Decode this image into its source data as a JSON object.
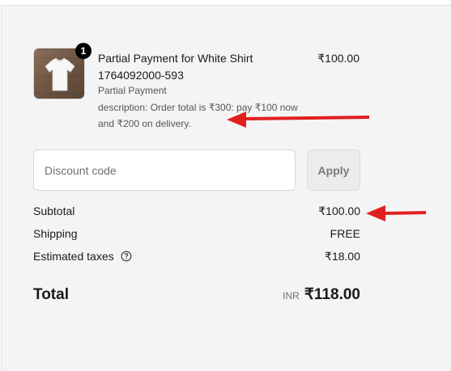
{
  "product": {
    "quantity_badge": "1",
    "title_line1": "Partial Payment for White Shirt",
    "title_line2": "1764092000-593",
    "variant": "Partial Payment",
    "description_line1": "description: Order total is ₹300: pay ₹100 now",
    "description_line2": "and ₹200 on delivery.",
    "price": "₹100.00",
    "image_icon": "white-tshirt-on-wood"
  },
  "discount": {
    "placeholder": "Discount code",
    "value": "",
    "apply_label": "Apply"
  },
  "summary": {
    "subtotal_label": "Subtotal",
    "subtotal_value": "₹100.00",
    "shipping_label": "Shipping",
    "shipping_value": "FREE",
    "taxes_label": "Estimated taxes",
    "taxes_value": "₹18.00",
    "taxes_icon": "question-circle-icon",
    "total_label": "Total",
    "currency": "INR",
    "total_value": "₹118.00"
  },
  "annotations": {
    "arrow_color": "#e0201e"
  }
}
